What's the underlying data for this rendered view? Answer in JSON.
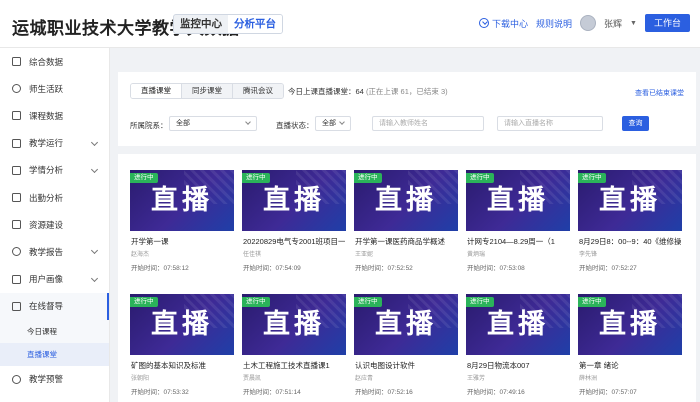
{
  "header": {
    "title": "运城职业技术大学教学大数据",
    "tabs": [
      {
        "label": "监控中心"
      },
      {
        "label": "分析平台"
      }
    ],
    "download": "下载中心",
    "rules": "规则说明",
    "user": "张辉",
    "workbench": "工作台"
  },
  "sidebar": {
    "items": [
      {
        "label": "综合数据"
      },
      {
        "label": "师生活跃"
      },
      {
        "label": "课程数据"
      },
      {
        "label": "教学运行"
      },
      {
        "label": "学情分析"
      },
      {
        "label": "出勤分析"
      },
      {
        "label": "资源建设"
      },
      {
        "label": "教学报告"
      },
      {
        "label": "用户画像"
      },
      {
        "label": "在线督导"
      },
      {
        "label": "教学预警"
      }
    ],
    "subitems": [
      {
        "label": "今日课程"
      },
      {
        "label": "直播课堂"
      }
    ]
  },
  "filter": {
    "tabs": [
      {
        "label": "直播课堂"
      },
      {
        "label": "同步课堂"
      },
      {
        "label": "腾讯会议"
      }
    ],
    "summary_main": "今日上课直播课堂：64",
    "summary_sub": "(正在上课 61，已结束 3)",
    "ended_link": "查看已结束课堂",
    "college_label": "所属院系：",
    "college_value": "全部",
    "status_label": "直播状态：",
    "status_value": "全部",
    "teacher_placeholder": "请输入教师姓名",
    "live_placeholder": "请输入直播名称",
    "query": "查询"
  },
  "cards": {
    "badge": "进行中",
    "word": "直播",
    "time_label": "开始时间：",
    "items": [
      {
        "title": "开学第一课",
        "teacher": "赵海杰",
        "time": "07:58:12"
      },
      {
        "title": "20220829电气专2001班项目一任",
        "teacher": "任佳祺",
        "time": "07:54:09"
      },
      {
        "title": "开学第一课医药商品学概述",
        "teacher": "王亚妮",
        "time": "07:52:52"
      },
      {
        "title": "计网专2104—8.29周一（1",
        "teacher": "黄炳瑞",
        "time": "07:53:08"
      },
      {
        "title": "8月29日8：00--9：40《维修操作",
        "teacher": "李先锋",
        "time": "07:52:27"
      },
      {
        "title": "矿图的基本知识及标准",
        "teacher": "张朝阳",
        "time": "07:53:32"
      },
      {
        "title": "土木工程施工技术直播课1",
        "teacher": "贾晨凯",
        "time": "07:51:14"
      },
      {
        "title": "认识电图设计软件",
        "teacher": "赵应青",
        "time": "07:52:16"
      },
      {
        "title": "8月29日物流本007",
        "teacher": "王雅芳",
        "time": "07:49:16"
      },
      {
        "title": "第一章 绪论",
        "teacher": "薛林洲",
        "time": "07:57:07"
      }
    ]
  },
  "colors": {
    "accent": "#2b5fe0",
    "live_badge": "#2bb35a"
  }
}
